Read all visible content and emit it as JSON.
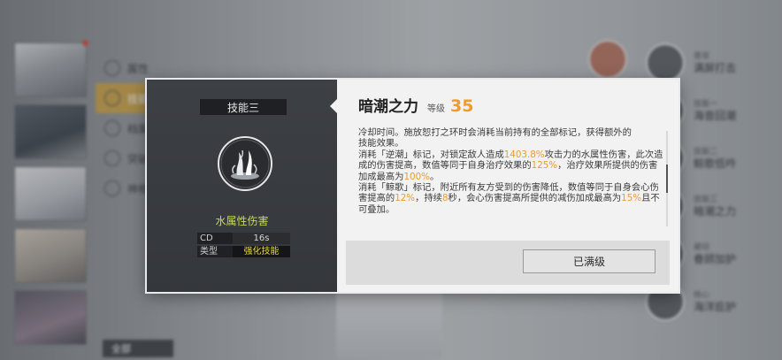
{
  "background": {
    "menu_items": [
      "属性",
      "技能",
      "档案",
      "突破",
      "神格"
    ],
    "bottom_filter": "全部",
    "skill_list": [
      {
        "tag": "普攻",
        "name": "满屏打击"
      },
      {
        "tag": "技能一",
        "name": "海音回潮"
      },
      {
        "tag": "技能二",
        "name": "鲸歌低吟"
      },
      {
        "tag": "技能三",
        "name": "暗潮之力"
      },
      {
        "tag": "被动",
        "name": "眷顾加护"
      },
      {
        "tag": "核心",
        "name": "海洋庇护"
      }
    ]
  },
  "dialog": {
    "slot_title": "技能三",
    "skill_icon": "water-splash-icon",
    "damage_type": "水属性伤害",
    "stats": [
      {
        "key": "CD",
        "value": "16s"
      },
      {
        "key": "类型",
        "value": "强化技能"
      }
    ],
    "skill_name": "暗潮之力",
    "level_label": "等级",
    "level_value": "35",
    "description": {
      "line0": "冷却时间。施放恕打之环时会消耗当前持有的全部标记，获得额外的",
      "line1": "技能效果。",
      "p1_a": "消耗「逆潮」标记，对锁定敌人造成",
      "p1_h1": "1403.8%",
      "p1_b": "攻击力的水属性伤害，此次造成的伤害提高，数值等同于自身治疗效果的",
      "p1_h2": "125%",
      "p1_c": "，治疗效果所提供的伤害加成最高为",
      "p1_h3": "100%",
      "p1_d": "。",
      "p2_a": "消耗「鲸歌」标记，附近所有友方受到的伤害降低，数值等同于自身会心伤害提高的",
      "p2_h1": "12%",
      "p2_b": "，持续",
      "p2_h2": "8",
      "p2_c": "秒，会心伤害提高所提供的减伤加成最高为",
      "p2_h3": "15%",
      "p2_d": "且不可叠加。"
    },
    "button_label": "已满级"
  },
  "colors": {
    "highlight": "#ef9a32",
    "level": "#f09b2c",
    "damage_type": "#c7d95a",
    "skill_type": "#e7da3f"
  }
}
